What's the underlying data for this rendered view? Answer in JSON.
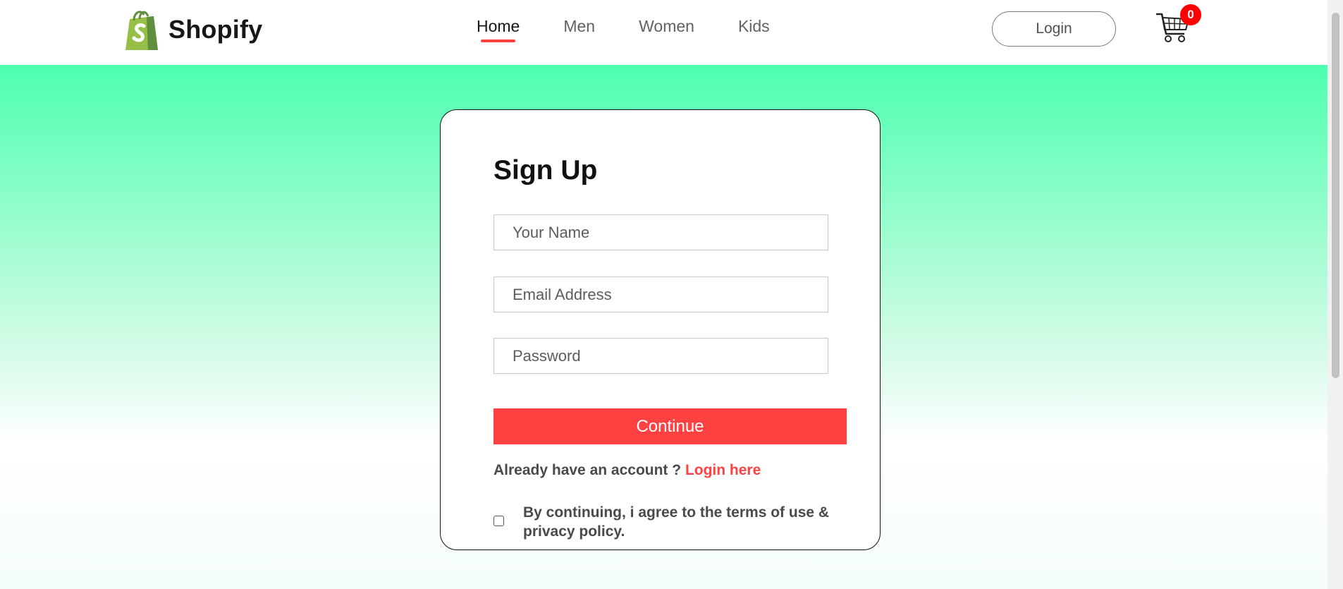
{
  "brand": {
    "name": "Shopify",
    "logo_icon": "shopping-bag-icon",
    "logo_color": "#95bf47"
  },
  "nav": {
    "items": [
      {
        "label": "Home",
        "active": true
      },
      {
        "label": "Men",
        "active": false
      },
      {
        "label": "Women",
        "active": false
      },
      {
        "label": "Kids",
        "active": false
      }
    ],
    "login_label": "Login",
    "cart_icon": "cart-icon",
    "cart_count": "0"
  },
  "signup": {
    "title": "Sign Up",
    "name_placeholder": "Your Name",
    "email_placeholder": "Email Address",
    "password_placeholder": "Password",
    "continue_label": "Continue",
    "have_account_text": "Already have an account ?",
    "login_link": "Login here",
    "agree_text": "By continuing, i agree to the terms of use & privacy policy.",
    "agree_checked": false
  },
  "colors": {
    "accent": "#ff4141",
    "gradient_top": "#4dffaf",
    "cart_badge": "#ff0000"
  }
}
